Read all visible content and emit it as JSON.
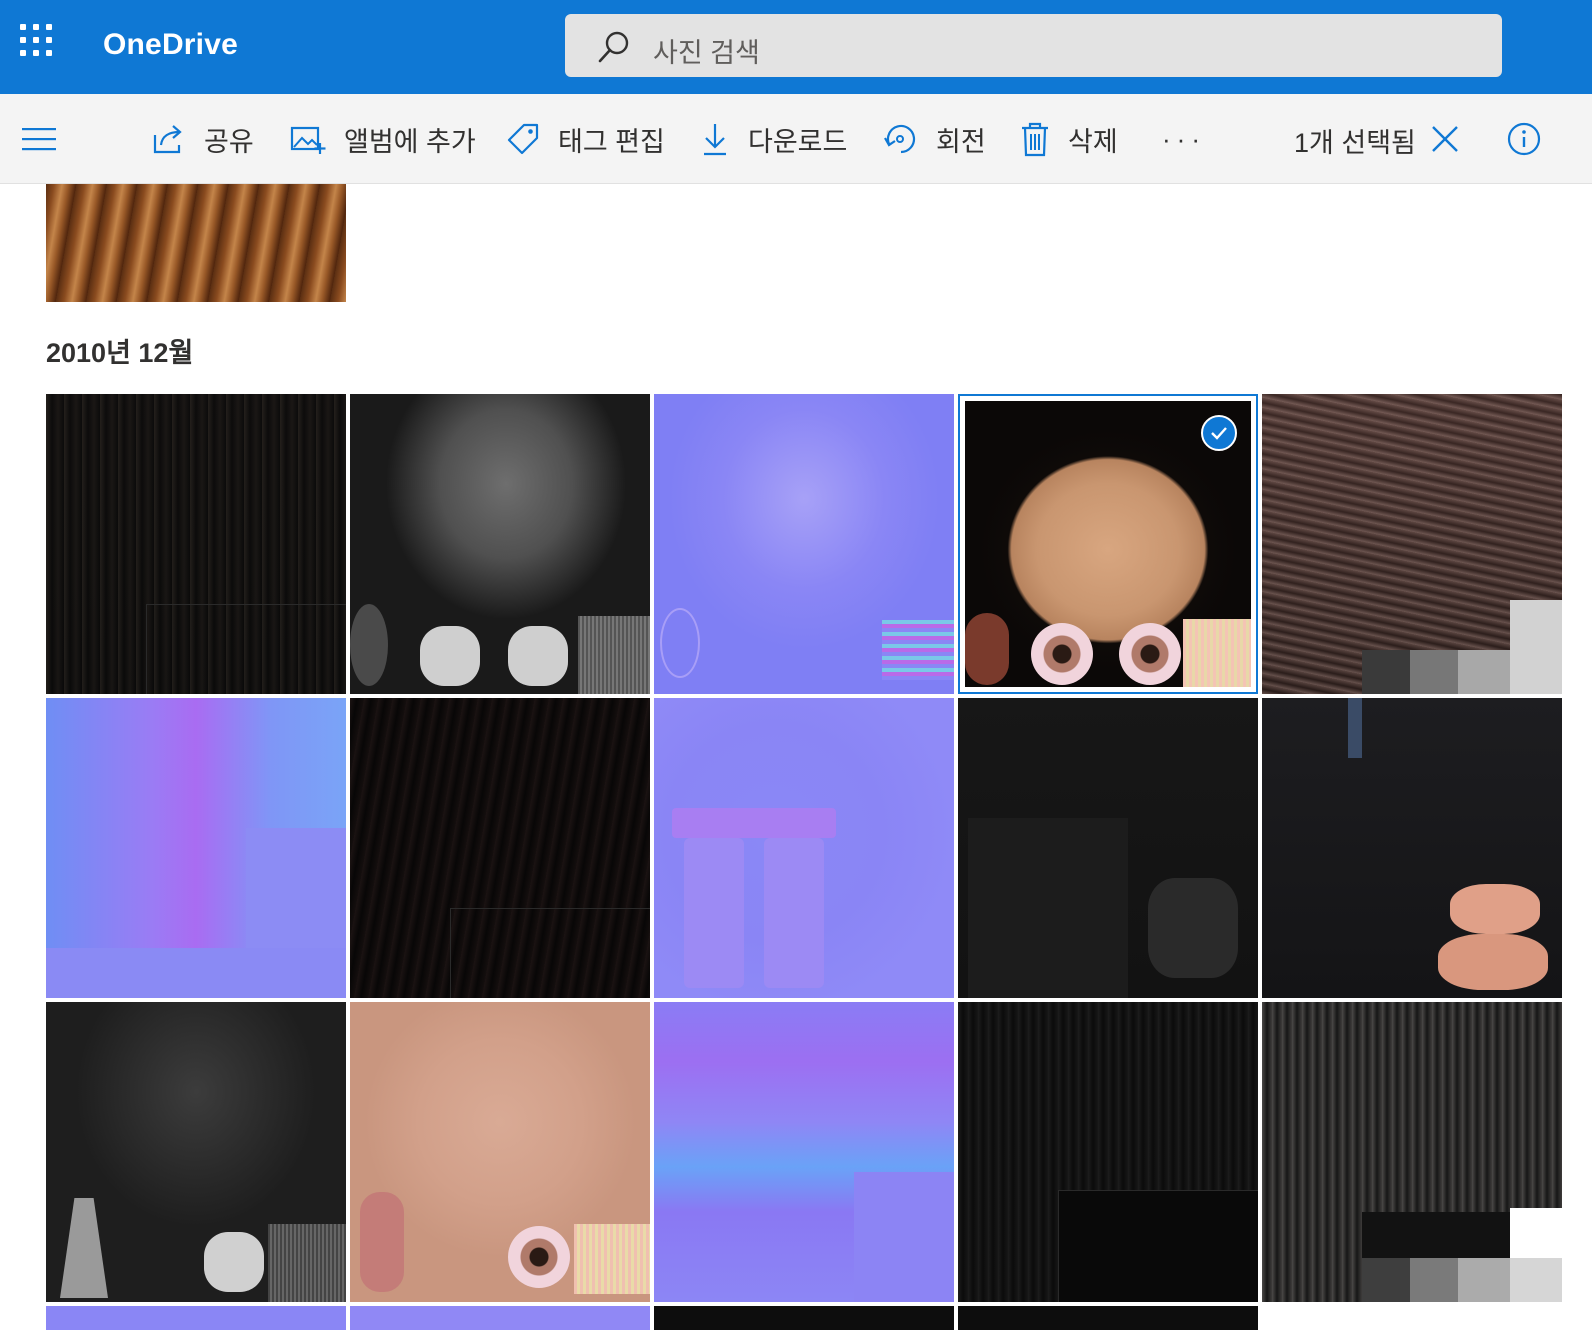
{
  "app": {
    "name": "OneDrive"
  },
  "search": {
    "placeholder": "사진 검색"
  },
  "commands": {
    "share": "공유",
    "add_to_album": "앨범에 추가",
    "edit_tags": "태그 편집",
    "download": "다운로드",
    "rotate": "회전",
    "delete": "삭제",
    "more": "···"
  },
  "selection": {
    "count_label": "1개 선택됨"
  },
  "section": {
    "title": "2010년 12월"
  },
  "colors": {
    "accent": "#0f78d4",
    "commandbar": "#f4f4f4"
  },
  "icons": [
    "waffle-icon",
    "search-icon",
    "hamburger-icon",
    "share-icon",
    "add-to-album-icon",
    "tag-icon",
    "download-icon",
    "rotate-icon",
    "delete-icon",
    "close-icon",
    "info-icon",
    "checkmark-icon"
  ],
  "photos": {
    "rows": [
      [
        "hair-dark",
        "face-gray",
        "face-normal",
        "face-skin-selected",
        "hair-pink"
      ],
      [
        "cloth-normal",
        "hair-dark-2",
        "body-normal",
        "cloth-dark",
        "cloth-dark-hands"
      ],
      [
        "face-gray-2",
        "face-pink",
        "band-normal",
        "hair-dark-3",
        "hair-gray"
      ]
    ],
    "selected_index": 3
  }
}
